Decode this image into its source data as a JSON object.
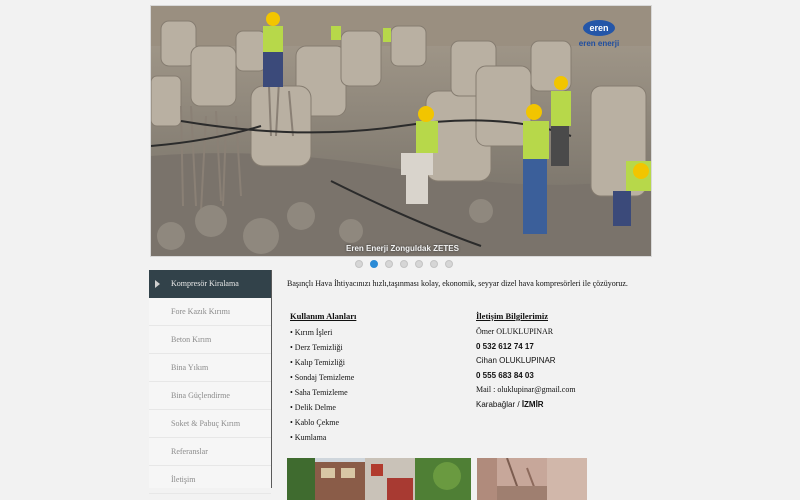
{
  "slider": {
    "caption": "Eren Enerji Zonguldak ZETES",
    "logo_badge": "eren",
    "logo_text": "eren enerji",
    "dots_count": 7,
    "active_dot": 1
  },
  "sidebar": {
    "items": [
      {
        "label": "Kompresör Kiralama"
      },
      {
        "label": "Fore Kazık Kırımı"
      },
      {
        "label": "Beton Kırım"
      },
      {
        "label": "Bina Yıkım"
      },
      {
        "label": "Bina Güçlendirme"
      },
      {
        "label": "Soket & Pabuç Kırım"
      },
      {
        "label": "Referanslar"
      },
      {
        "label": "İletişim"
      }
    ]
  },
  "main": {
    "intro": "Başınçlı Hava İhtiyacınızı hızlı,taşınması kolay, ekonomik, seyyar dizel hava kompresörleri ile çözüyoruz.",
    "usage_title": "Kullanım Alanları",
    "usage_items": [
      "• Kırım İşleri",
      "• Derz Temizliği",
      "• Kalıp Temizliği",
      "• Sondaj Temizleme",
      "• Saha Temizleme",
      "• Delik Delme",
      "• Kablo Çekme",
      "• Kumlama"
    ],
    "contact_title": "İletişim Bilgilerimiz",
    "contact": {
      "name1": "Ömer OLUKLUPINAR",
      "phone1": "0 532 612 74 17",
      "name2": "Cihan OLUKLUPINAR",
      "phone2": "0 555 683 84 03",
      "mail": "Mail : oluklupinar@gmail.com",
      "district": "Karabağlar / ",
      "city": "İZMİR"
    }
  }
}
